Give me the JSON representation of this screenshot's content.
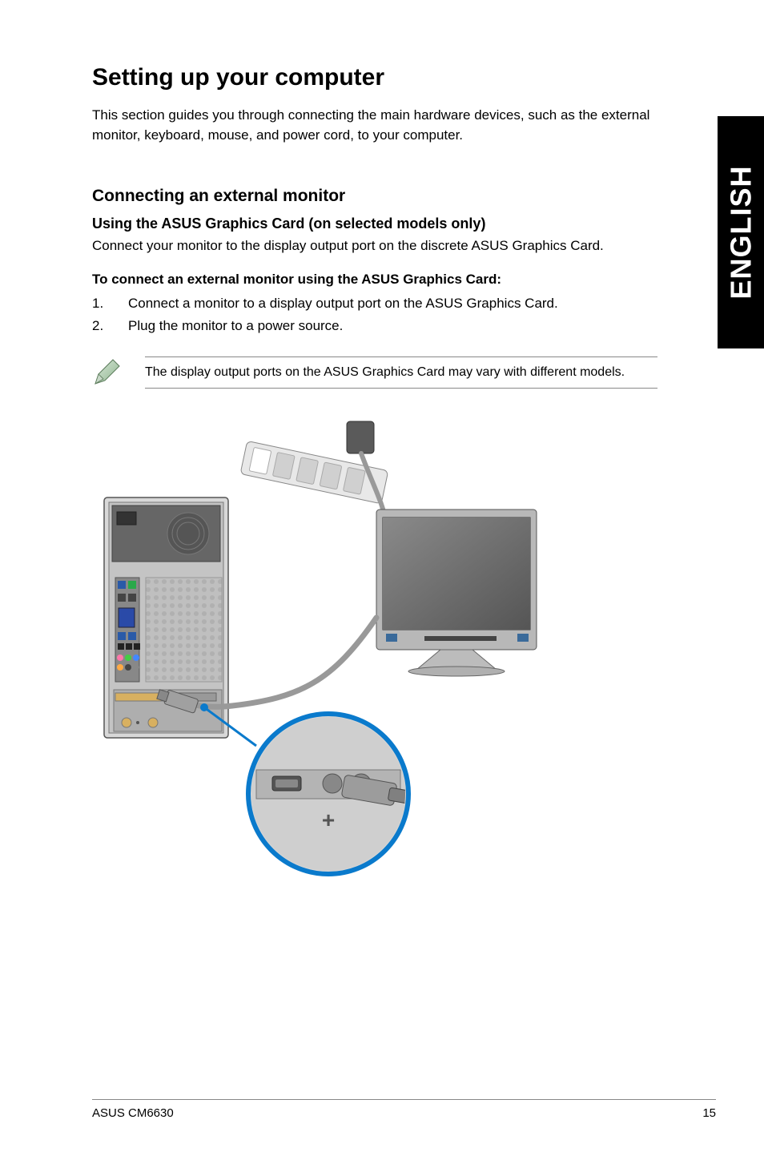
{
  "sideTab": "ENGLISH",
  "title": "Setting up your computer",
  "intro": "This section guides you through connecting the main hardware devices, such as the external monitor, keyboard, mouse, and power cord, to your computer.",
  "section": {
    "heading": "Connecting an external monitor",
    "subheading": "Using the ASUS Graphics Card (on selected models only)",
    "body": "Connect your monitor to the display output port on the discrete ASUS Graphics Card.",
    "procedureTitle": "To connect an external monitor using the ASUS Graphics Card:",
    "steps": [
      {
        "num": "1.",
        "text": "Connect a monitor to a display output port on the ASUS Graphics Card."
      },
      {
        "num": "2.",
        "text": "Plug the monitor to a power source."
      }
    ],
    "note": "The display output ports on the ASUS Graphics Card may vary with different models."
  },
  "footer": {
    "product": "ASUS CM6630",
    "page": "15"
  }
}
